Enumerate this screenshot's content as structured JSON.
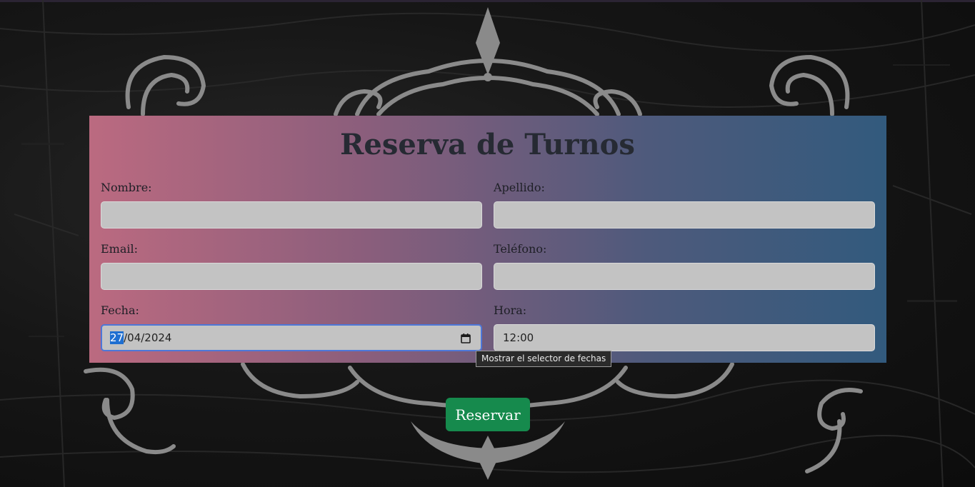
{
  "form": {
    "title": "Reserva de Turnos",
    "nombre_label": "Nombre:",
    "apellido_label": "Apellido:",
    "email_label": "Email:",
    "telefono_label": "Teléfono:",
    "fecha_label": "Fecha:",
    "hora_label": "Hora:",
    "nombre_value": "",
    "apellido_value": "",
    "email_value": "",
    "telefono_value": "",
    "fecha_day": "27",
    "fecha_rest": "/04/2024",
    "hora_value": "12:00",
    "submit_label": "Reservar"
  },
  "tooltip": {
    "text": "Mostrar el selector de fechas"
  },
  "icons": {
    "date_picker": "calendar-icon"
  },
  "colors": {
    "panel_gradient_start": "#bb6a80",
    "panel_gradient_end": "#325a7d",
    "submit_button": "#168a4d",
    "input_background": "#c3c3c3",
    "focus_ring": "#4d77d8",
    "text_selection": "#1f6fd1"
  }
}
